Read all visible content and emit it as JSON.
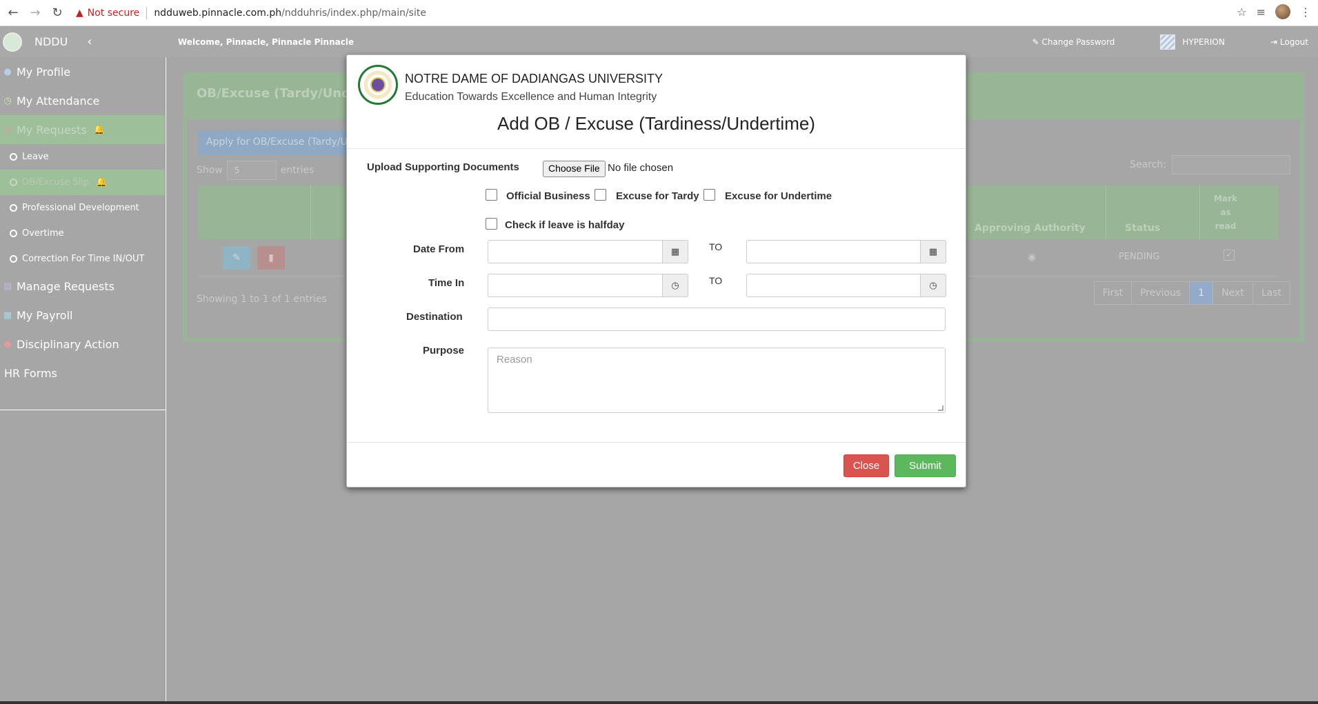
{
  "browser": {
    "back_icon": "arrow-left-icon",
    "forward_icon": "arrow-right-icon",
    "reload_icon": "reload-icon",
    "security_label": "Not secure",
    "url_host": "ndduweb.pinnacle.com.ph",
    "url_path": "/ndduhris/index.php/main/site"
  },
  "header": {
    "brand": "NDDU",
    "welcome": "Welcome, Pinnacle, Pinnacle Pinnacle",
    "change_password": "Change Password",
    "hyperion": "HYPERION",
    "logout": "Logout"
  },
  "sidebar": {
    "items": [
      {
        "label": "My Profile"
      },
      {
        "label": "My Attendance"
      },
      {
        "label": "My Requests"
      },
      {
        "label": "Leave"
      },
      {
        "label": "OB/Excuse Slip"
      },
      {
        "label": "Professional Development"
      },
      {
        "label": "Overtime"
      },
      {
        "label": "Correction For Time IN/OUT"
      },
      {
        "label": "Manage Requests"
      },
      {
        "label": "My Payroll"
      },
      {
        "label": "Disciplinary Action"
      },
      {
        "label": "HR Forms"
      }
    ]
  },
  "background": {
    "panel_title": "OB/Excuse (Tardy/Unde",
    "apply_button": "Apply for OB/Excuse (Tardy/U",
    "show_label": "Show",
    "show_value": "5",
    "entries_label": "entries",
    "search_label": "Search:",
    "columns": {
      "approving": "Approving Authority",
      "status": "Status",
      "mark": "Mark as read"
    },
    "row_status": "PENDING",
    "showing": "Showing 1 to 1 of 1 entries",
    "pager": [
      "First",
      "Previous",
      "1",
      "Next",
      "Last"
    ]
  },
  "modal": {
    "university": "NOTRE DAME OF DADIANGAS UNIVERSITY",
    "motto": "Education Towards Excellence and Human Integrity",
    "title": "Add OB / Excuse (Tardiness/Undertime)",
    "upload_label": "Upload Supporting Documents",
    "choose_file": "Choose File",
    "no_file": "No file chosen",
    "checkboxes": {
      "official_business": "Official Business",
      "excuse_tardy": "Excuse for Tardy",
      "excuse_undertime": "Excuse for Undertime",
      "halfday": "Check if leave is halfday"
    },
    "date_from_label": "Date From",
    "time_in_label": "Time In",
    "to_label": "TO",
    "destination_label": "Destination",
    "purpose_label": "Purpose",
    "purpose_placeholder": "Reason",
    "close_button": "Close",
    "submit_button": "Submit"
  }
}
